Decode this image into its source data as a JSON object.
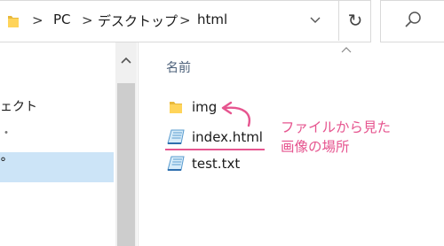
{
  "address_bar": {
    "breadcrumbs": [
      "PC",
      "デスクトップ",
      "html"
    ],
    "separator": ">",
    "refresh_glyph": "↻",
    "folder_icon": "folder-icon"
  },
  "search": {
    "icon": "search-icon"
  },
  "nav_pane": {
    "items": [
      {
        "label": "ェクト"
      },
      {
        "label": "・"
      },
      {
        "label": "°",
        "selected": true
      }
    ]
  },
  "content": {
    "column_header": "名前",
    "files": [
      {
        "name": "img",
        "icon": "folder-icon"
      },
      {
        "name": "index.html",
        "icon": "html-file-icon"
      },
      {
        "name": "test.txt",
        "icon": "text-file-icon"
      }
    ]
  },
  "annotation": {
    "line1": "ファイルから見た",
    "line2": "画像の場所",
    "color": "#e6558f"
  },
  "colors": {
    "accent_pink": "#e6558f",
    "selection": "#cce4f7",
    "folder_yellow": "#ffd45a"
  }
}
